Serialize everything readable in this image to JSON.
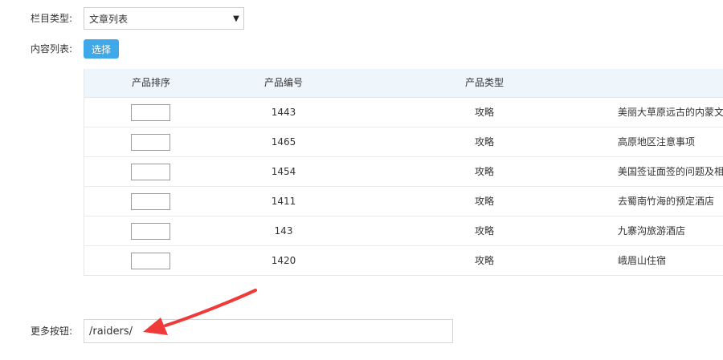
{
  "form": {
    "column_type_label": "栏目类型:",
    "column_type_value": "文章列表",
    "content_list_label": "内容列表:",
    "choose_label": "选择",
    "more_button_label": "更多按钮:",
    "more_button_value": "/raiders/"
  },
  "table": {
    "headers": [
      "产品排序",
      "产品编号",
      "产品类型",
      ""
    ],
    "rows": [
      {
        "sort": "",
        "id": "1443",
        "type": "攻略",
        "title": "美丽大草原远古的内蒙文"
      },
      {
        "sort": "",
        "id": "1465",
        "type": "攻略",
        "title": "高原地区注意事项"
      },
      {
        "sort": "",
        "id": "1454",
        "type": "攻略",
        "title": "美国签证面签的问题及相"
      },
      {
        "sort": "",
        "id": "1411",
        "type": "攻略",
        "title": "去蜀南竹海的预定酒店"
      },
      {
        "sort": "",
        "id": "143",
        "type": "攻略",
        "title": "九寨沟旅游酒店"
      },
      {
        "sort": "",
        "id": "1420",
        "type": "攻略",
        "title": "峨眉山住宿"
      }
    ]
  },
  "colors": {
    "accent": "#3ea8e8",
    "header_bg": "#eef6fc",
    "annotation_arrow": "#f03a3a"
  },
  "icons": {
    "select_caret": "▼"
  }
}
